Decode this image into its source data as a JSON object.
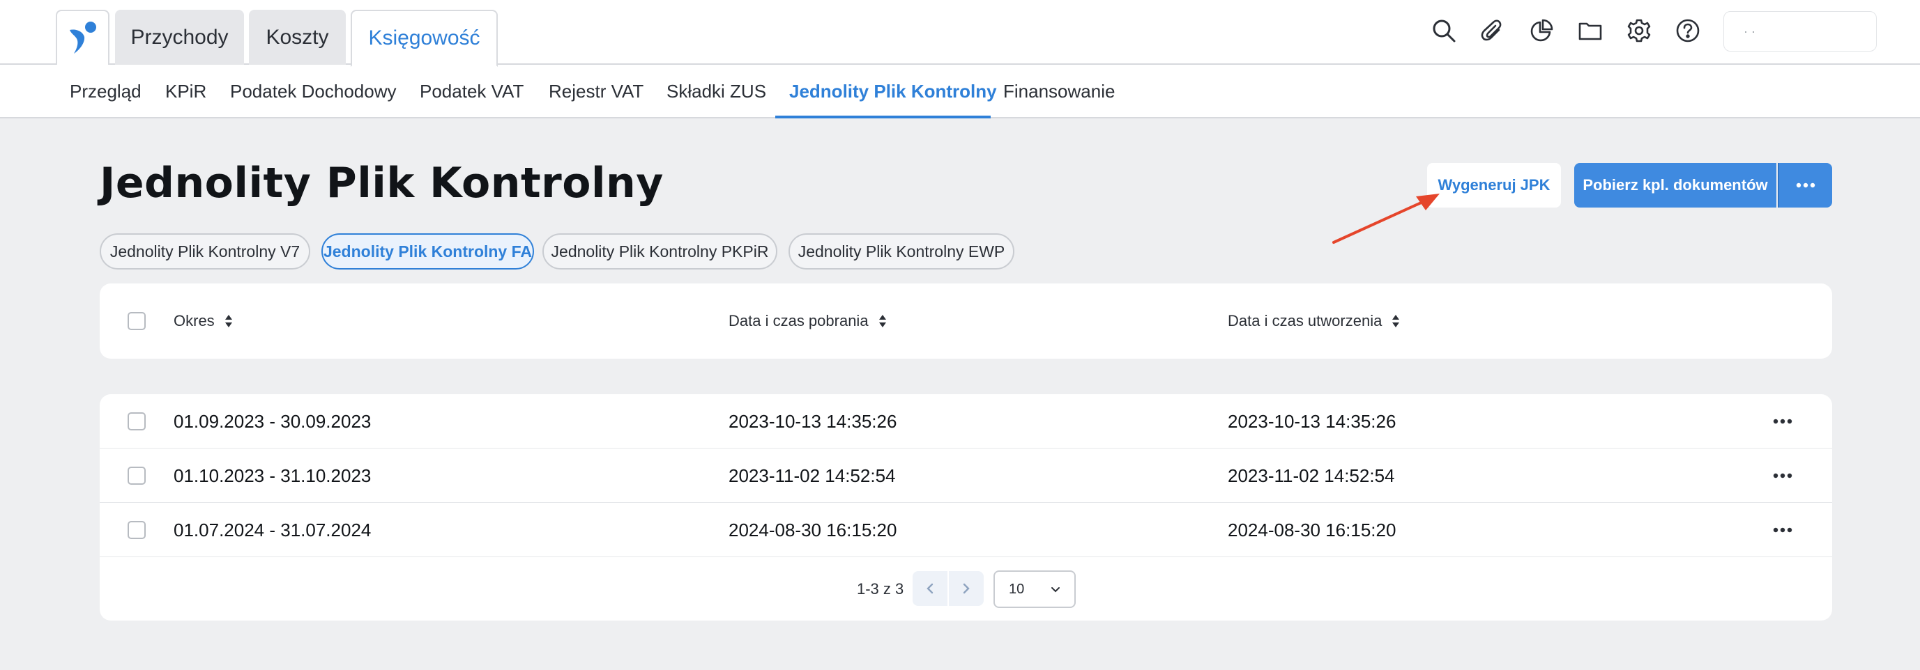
{
  "topbar": {
    "tabs": [
      {
        "label": "Przychody",
        "active": false
      },
      {
        "label": "Koszty",
        "active": false
      },
      {
        "label": "Księgowość",
        "active": true
      }
    ],
    "icons": [
      "search-icon",
      "paperclip-icon",
      "pie-chart-icon",
      "folder-icon",
      "gear-icon",
      "help-icon"
    ],
    "user_box_text": "·       ·"
  },
  "subnav": {
    "items": [
      {
        "label": "Przegląd",
        "active": false
      },
      {
        "label": "KPiR",
        "active": false
      },
      {
        "label": "Podatek Dochodowy",
        "active": false
      },
      {
        "label": "Podatek VAT",
        "active": false
      },
      {
        "label": "Rejestr VAT",
        "active": false
      },
      {
        "label": "Składki ZUS",
        "active": false
      },
      {
        "label": "Jednolity Plik Kontrolny",
        "active": true
      },
      {
        "label": "Finansowanie",
        "active": false
      }
    ]
  },
  "page": {
    "title": "Jednolity Plik Kontrolny",
    "generate_button": "Wygeneruj JPK",
    "download_button": "Pobierz kpl. dokumentów"
  },
  "filters": [
    {
      "label": "Jednolity Plik Kontrolny V7",
      "active": false
    },
    {
      "label": "Jednolity Plik Kontrolny FA",
      "active": true
    },
    {
      "label": "Jednolity Plik Kontrolny PKPiR",
      "active": false
    },
    {
      "label": "Jednolity Plik Kontrolny EWP",
      "active": false
    }
  ],
  "table": {
    "columns": [
      "Okres",
      "Data i czas pobrania",
      "Data i czas utworzenia"
    ],
    "rows": [
      {
        "period": "01.09.2023 - 30.09.2023",
        "downloaded": "2023-10-13 14:35:26",
        "created": "2023-10-13 14:35:26"
      },
      {
        "period": "01.10.2023 - 31.10.2023",
        "downloaded": "2023-11-02 14:52:54",
        "created": "2023-11-02 14:52:54"
      },
      {
        "period": "01.07.2024 - 31.07.2024",
        "downloaded": "2024-08-30 16:15:20",
        "created": "2024-08-30 16:15:20"
      }
    ]
  },
  "pagination": {
    "range_text": "1-3 z 3",
    "per_page": "10"
  },
  "colors": {
    "accent": "#2f80d8",
    "primary_button": "#3f8ae0",
    "background": "#eeeff1",
    "annotation_arrow": "#e5452b"
  }
}
